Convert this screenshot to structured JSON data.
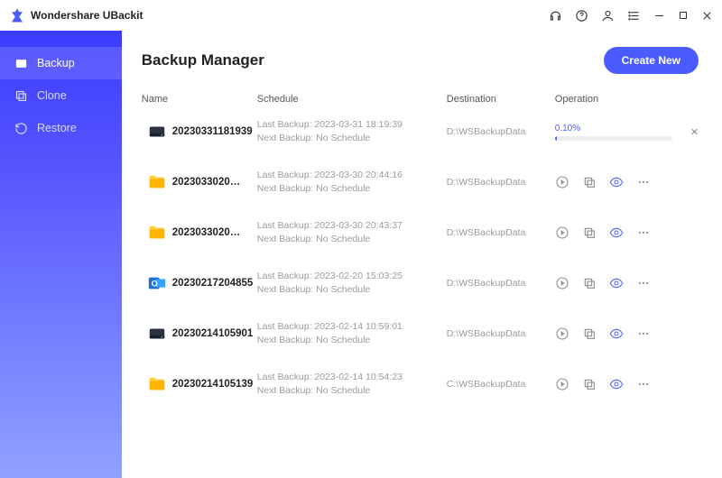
{
  "titlebar": {
    "brand": "Wondershare UBackit"
  },
  "sidebar": {
    "items": [
      {
        "label": "Backup",
        "icon": "backup-icon",
        "active": true
      },
      {
        "label": "Clone",
        "icon": "clone-icon"
      },
      {
        "label": "Restore",
        "icon": "restore-icon"
      }
    ]
  },
  "header": {
    "title": "Backup Manager",
    "create_label": "Create New"
  },
  "columns": {
    "name": "Name",
    "schedule": "Schedule",
    "destination": "Destination",
    "operation": "Operation"
  },
  "rows": [
    {
      "type": "disk",
      "name": "20230331181939",
      "last": "Last Backup: 2023-03-31 18:19:39",
      "next": "Next Backup: No Schedule",
      "dest": "D:\\WSBackupData",
      "progress": {
        "pct": "0.10%"
      }
    },
    {
      "type": "folder",
      "name": "2023033020…",
      "last": "Last Backup: 2023-03-30 20:44:16",
      "next": "Next Backup: No Schedule",
      "dest": "D:\\WSBackupData"
    },
    {
      "type": "folder",
      "name": "2023033020…",
      "last": "Last Backup: 2023-03-30 20:43:37",
      "next": "Next Backup: No Schedule",
      "dest": "D:\\WSBackupData"
    },
    {
      "type": "outlook",
      "name": "20230217204855",
      "last": "Last Backup: 2023-02-20 15:03:25",
      "next": "Next Backup: No Schedule",
      "dest": "D:\\WSBackupData"
    },
    {
      "type": "disk",
      "name": "20230214105901",
      "last": "Last Backup: 2023-02-14 10:59:01",
      "next": "Next Backup: No Schedule",
      "dest": "D:\\WSBackupData"
    },
    {
      "type": "folder",
      "name": "20230214105139",
      "last": "Last Backup: 2023-02-14 10:54:23",
      "next": "Next Backup: No Schedule",
      "dest": "C:\\WSBackupData"
    }
  ]
}
